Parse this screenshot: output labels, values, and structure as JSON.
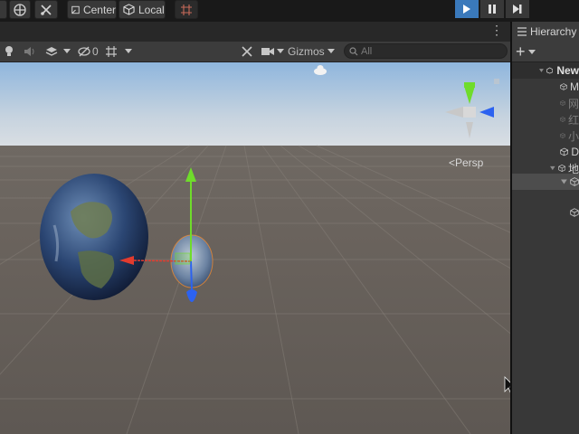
{
  "toolbar": {
    "pivot_label": "Center",
    "space_label": "Local"
  },
  "scene": {
    "layers_count": "0",
    "gizmos_label": "Gizmos",
    "search_placeholder": "All",
    "persp_label": "<Persp"
  },
  "hierarchy": {
    "tab_label": "Hierarchy",
    "scene_name": "New",
    "items": [
      {
        "label": "M",
        "dimmed": false
      },
      {
        "label": "网",
        "dimmed": true
      },
      {
        "label": "红",
        "dimmed": true
      },
      {
        "label": "小",
        "dimmed": true
      },
      {
        "label": "D",
        "dimmed": false
      },
      {
        "label": "地",
        "dimmed": false
      },
      {
        "label": "",
        "dimmed": false
      }
    ]
  },
  "colors": {
    "accent_play": "#3a79bb",
    "axis_x": "#e23b2e",
    "axis_y": "#6fdc2b",
    "axis_z": "#2c62f0",
    "selected_row": "#4d4d4d"
  }
}
